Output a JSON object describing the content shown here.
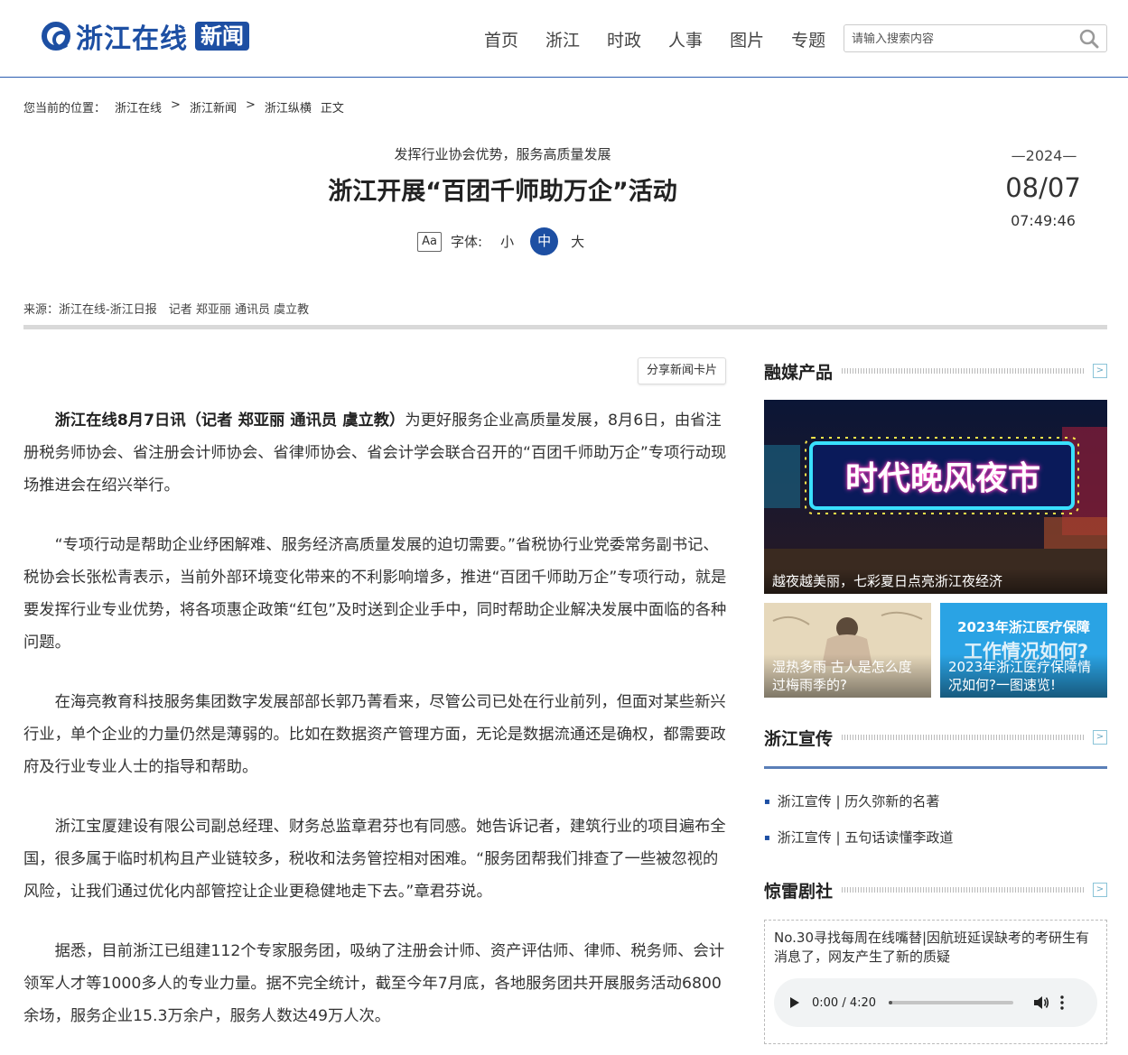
{
  "header": {
    "logo_text": "浙江在线",
    "logo_badge": "新闻",
    "nav": [
      "首页",
      "浙江",
      "时政",
      "人事",
      "图片",
      "专题"
    ],
    "search_placeholder": "请输入搜索内容"
  },
  "breadcrumb": {
    "prefix": "您当前的位置：",
    "items": [
      "浙江在线",
      ">",
      "浙江新闻",
      ">",
      "浙江纵横",
      "正文"
    ]
  },
  "article": {
    "subtitle": "发挥行业协会优势，服务高质量发展",
    "title": "浙江开展“百团千师助万企”活动",
    "font_label": "字体:",
    "font_icon": "Aa",
    "font_sizes": [
      "小",
      "中",
      "大"
    ],
    "font_size_active": "中",
    "date_year": "—2024—",
    "date_md": "08/07",
    "date_time": "07:49:46",
    "source": "来源：浙江在线-浙江日报　记者 郑亚丽 通讯员 虞立教",
    "share_label": "分享新闻卡片",
    "lead_bold": "浙江在线8月7日讯（记者 郑亚丽 通讯员 虞立教）",
    "lead_rest": "为更好服务企业高质量发展，8月6日，由省注册税务师协会、省注册会计师协会、省律师协会、省会计学会联合召开的“百团千师助万企”专项行动现场推进会在绍兴举行。",
    "paragraphs": [
      "“专项行动是帮助企业纾困解难、服务经济高质量发展的迫切需要。”省税协行业党委常务副书记、税协会长张松青表示，当前外部环境变化带来的不利影响增多，推进“百团千师助万企”专项行动，就是要发挥行业专业优势，将各项惠企政策“红包”及时送到企业手中，同时帮助企业解决发展中面临的各种问题。",
      "在海亮教育科技服务集团数字发展部部长郭乃菁看来，尽管公司已处在行业前列，但面对某些新兴行业，单个企业的力量仍然是薄弱的。比如在数据资产管理方面，无论是数据流通还是确权，都需要政府及行业专业人士的指导和帮助。",
      "浙江宝厦建设有限公司副总经理、财务总监章君芬也有同感。她告诉记者，建筑行业的项目遍布全国，很多属于临时机构且产业链较多，税收和法务管控相对困难。“服务团帮我们排查了一些被忽视的风险，让我们通过优化内部管控让企业更稳健地走下去。”章君芬说。",
      "据悉，目前浙江已组建112个专家服务团，吸纳了注册会计师、资产评估师、律师、税务师、会计领军人才等1000多人的专业力量。据不完全统计，截至今年7月底，各地服务团共开展服务活动6800余场，服务企业15.3万余户，服务人数达49万人次。"
    ]
  },
  "sidebar": {
    "media": {
      "title": "融媒产品",
      "more": ">",
      "big_sign_text": "时代晚风夜市",
      "big_caption": "越夜越美丽，七彩夏日点亮浙江夜经济",
      "small1_caption": "湿热多雨 古人是怎么度过梅雨季的?",
      "small2_banner": "2023年浙江医疗保障",
      "small2_banner2": "工作情况如何?",
      "small2_caption": "2023年浙江医疗保障情况如何?一图速览!"
    },
    "xuanchuan": {
      "title": "浙江宣传",
      "more": ">",
      "items": [
        "浙江宣传 | 历久弥新的名著",
        "浙江宣传 | 五句话读懂李政道"
      ]
    },
    "juchang": {
      "title": "惊雷剧社",
      "more": ">",
      "audio_title": "No.30寻找每周在线嘴替|因航班延误缺考的考研生有消息了，网友产生了新的质疑",
      "audio_time": "0:00 / 4:20",
      "audio_progress": 0
    }
  },
  "colors": {
    "brand": "#1d4fa3",
    "rule": "#d9d9d9"
  }
}
